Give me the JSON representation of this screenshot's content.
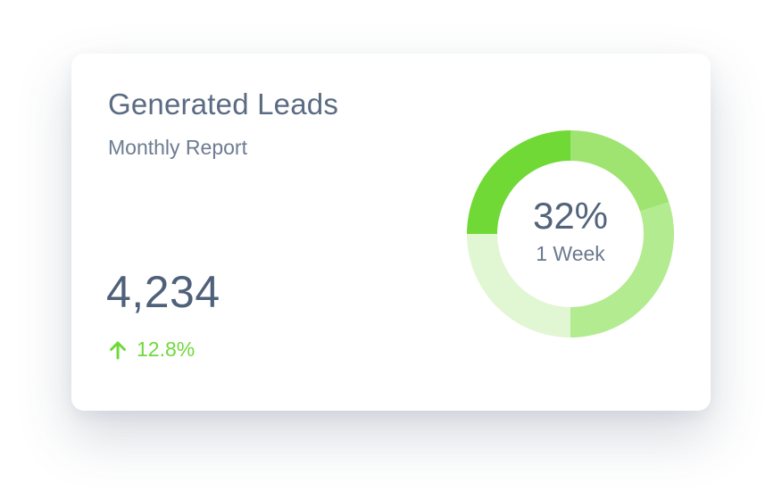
{
  "card": {
    "title": "Generated Leads",
    "subtitle": "Monthly Report",
    "total_leads": "4,234",
    "change": {
      "icon": "arrow-up-icon",
      "value": "12.8%",
      "color": "#6fd93b"
    }
  },
  "chart_data": {
    "type": "pie",
    "variant": "donut",
    "center_value": "32%",
    "center_label": "1 Week",
    "segments": [
      {
        "value": 20,
        "color": "#9fe370"
      },
      {
        "value": 30,
        "color": "#b3eb90"
      },
      {
        "value": 25,
        "color": "#e1f6d2"
      },
      {
        "value": 25,
        "color": "#70d935"
      }
    ]
  }
}
